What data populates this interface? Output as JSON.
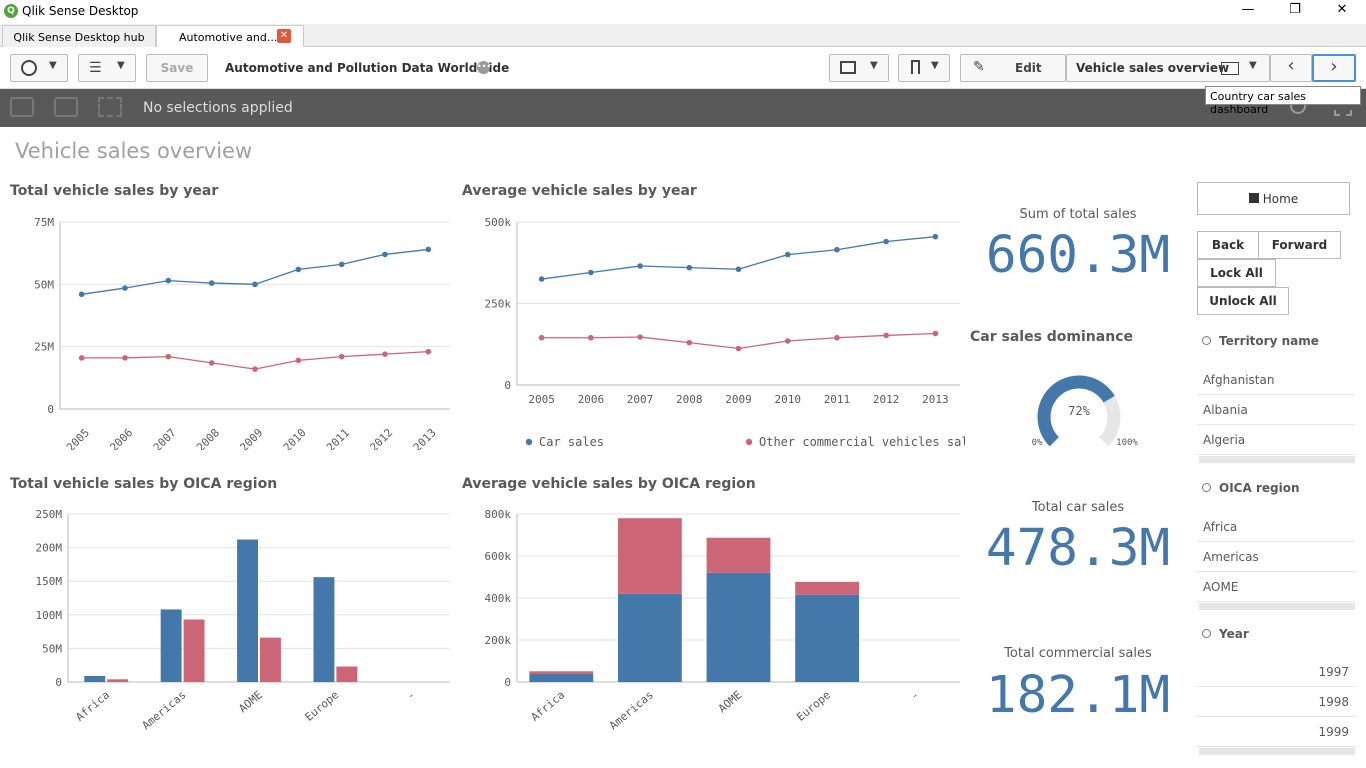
{
  "window": {
    "title": "Qlik Sense Desktop"
  },
  "tabs": [
    {
      "label": "Qlik Sense Desktop hub"
    },
    {
      "label": "Automotive and..."
    }
  ],
  "toolbar": {
    "save": "Save",
    "app_title": "Automotive and Pollution Data Worldwide",
    "edit": "Edit",
    "sheet": "Vehicle sales overview",
    "tooltip": "Country car sales dashboard"
  },
  "selections": {
    "text": "No selections applied"
  },
  "page": {
    "title": "Vehicle sales overview"
  },
  "colors": {
    "blue": "#4477aa",
    "red": "#cc6677"
  },
  "charts": {
    "c1": {
      "title": "Total vehicle sales by year"
    },
    "c2": {
      "title": "Average vehicle sales by year"
    },
    "c3": {
      "title": "Total vehicle sales by OICA region"
    },
    "c4": {
      "title": "Average vehicle sales by OICA region"
    }
  },
  "chart_data": [
    {
      "type": "line",
      "title": "Total vehicle sales by year",
      "x": [
        "2005",
        "2006",
        "2007",
        "2008",
        "2009",
        "2010",
        "2011",
        "2012",
        "2013"
      ],
      "yticks": [
        "0",
        "25M",
        "50M",
        "75M"
      ],
      "ylim": [
        0,
        75000000
      ],
      "series": [
        {
          "name": "Car sales",
          "values": [
            46000000,
            48500000,
            51500000,
            50500000,
            50000000,
            56000000,
            58000000,
            62000000,
            64000000
          ]
        },
        {
          "name": "Other commercial vehicles sales",
          "values": [
            20500000,
            20500000,
            21000000,
            18500000,
            16000000,
            19500000,
            21000000,
            22000000,
            23000000
          ]
        }
      ]
    },
    {
      "type": "line",
      "title": "Average vehicle sales by year",
      "x": [
        "2005",
        "2006",
        "2007",
        "2008",
        "2009",
        "2010",
        "2011",
        "2012",
        "2013"
      ],
      "yticks": [
        "0",
        "250k",
        "500k"
      ],
      "ylim": [
        0,
        500000
      ],
      "legend": [
        "Car sales",
        "Other commercial vehicles sales"
      ],
      "series": [
        {
          "name": "Car sales",
          "values": [
            325000,
            345000,
            365000,
            360000,
            355000,
            400000,
            415000,
            440000,
            455000
          ]
        },
        {
          "name": "Other commercial vehicles sales",
          "values": [
            145000,
            145000,
            147000,
            130000,
            112000,
            135000,
            145000,
            152000,
            158000
          ]
        }
      ]
    },
    {
      "type": "bar",
      "title": "Total vehicle sales by OICA region",
      "categories": [
        "Africa",
        "Americas",
        "AOME",
        "Europe",
        "-"
      ],
      "yticks": [
        "0",
        "50M",
        "100M",
        "150M",
        "200M",
        "250M"
      ],
      "ylim": [
        0,
        250000000
      ],
      "series": [
        {
          "name": "Car sales",
          "values": [
            9000000,
            108000000,
            212000000,
            156000000,
            0
          ]
        },
        {
          "name": "Other commercial vehicles sales",
          "values": [
            4000000,
            93000000,
            66000000,
            23000000,
            0
          ]
        }
      ]
    },
    {
      "type": "bar",
      "title": "Average vehicle sales by OICA region",
      "stacked": true,
      "categories": [
        "Africa",
        "Americas",
        "AOME",
        "Europe",
        "-"
      ],
      "yticks": [
        "0",
        "200k",
        "400k",
        "600k",
        "800k"
      ],
      "ylim": [
        0,
        800000
      ],
      "series": [
        {
          "name": "Car sales",
          "values": [
            38000,
            420000,
            520000,
            415000,
            0
          ]
        },
        {
          "name": "Other commercial vehicles sales",
          "values": [
            13000,
            360000,
            167000,
            62000,
            0
          ]
        }
      ]
    }
  ],
  "kpis": {
    "sum_label": "Sum of total sales",
    "sum_value": "660.3M",
    "dom_title": "Car sales dominance",
    "gauge_value": "72%",
    "gauge_min": "0%",
    "gauge_max": "100%",
    "gauge_fraction": 0.72,
    "car_label": "Total car sales",
    "car_value": "478.3M",
    "com_label": "Total commercial sales",
    "com_value": "182.1M"
  },
  "filters": {
    "home": "Home",
    "back": "Back",
    "forward": "Forward",
    "lock": "Lock All",
    "unlock": "Unlock All",
    "territory": {
      "title": "Territory name",
      "items": [
        "Afghanistan",
        "Albania",
        "Algeria"
      ]
    },
    "oica": {
      "title": "OICA region",
      "items": [
        "Africa",
        "Americas",
        "AOME"
      ]
    },
    "year": {
      "title": "Year",
      "items": [
        "1997",
        "1998",
        "1999"
      ]
    }
  }
}
